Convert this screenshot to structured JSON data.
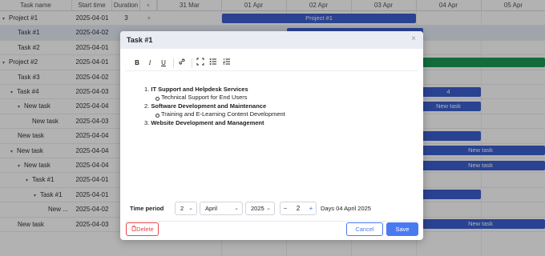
{
  "grid": {
    "columns": [
      "Task name",
      "Start time",
      "Duration",
      "+"
    ]
  },
  "scale": [
    "31 Mar",
    "01 Apr",
    "02 Apr",
    "03 Apr",
    "04 Apr",
    "05 Apr"
  ],
  "rows": [
    {
      "name": "Project #1",
      "start": "2025-04-01",
      "duration": "3",
      "add": "+",
      "caret": "▾"
    },
    {
      "name": "Task #1",
      "start": "2025-04-02"
    },
    {
      "name": "Task #2",
      "start": "2025-04-01"
    },
    {
      "name": "Project #2",
      "start": "2025-04-01",
      "caret": "▾"
    },
    {
      "name": "Task #3",
      "start": "2025-04-02"
    },
    {
      "name": "Task #4",
      "start": "2025-04-03",
      "caret": "▾"
    },
    {
      "name": "New task",
      "start": "2025-04-04",
      "caret": "▾"
    },
    {
      "name": "New task",
      "start": "2025-04-03"
    },
    {
      "name": "New task",
      "start": "2025-04-04"
    },
    {
      "name": "New task",
      "start": "2025-04-04",
      "caret": "▾"
    },
    {
      "name": "New task",
      "start": "2025-04-04",
      "caret": "▾"
    },
    {
      "name": "Task #1",
      "start": "2025-04-01",
      "caret": "▾"
    },
    {
      "name": "Task #1",
      "start": "2025-04-01",
      "caret": "▾"
    },
    {
      "name": "New ...",
      "start": "2025-04-02"
    },
    {
      "name": "New task",
      "start": "2025-04-03"
    }
  ],
  "bars": {
    "project1": "Project #1",
    "task4_partial": "4",
    "new_task_labels": [
      "New task",
      "New task",
      "New task",
      "New task"
    ]
  },
  "modal": {
    "title": "Task #1",
    "close": "×",
    "toolbar": {
      "bold": "B",
      "italic": "I",
      "underline": "U",
      "link": "🔗",
      "fullscreen": "⛶",
      "bulleted_list": "☰",
      "numbered_list": "☰"
    },
    "content": [
      {
        "num": "1.",
        "text": "IT Support and Helpdesk Services",
        "sub": [
          "Technical Support for End Users"
        ]
      },
      {
        "num": "2.",
        "text": "Software Development and Maintenance",
        "sub": [
          "Training and E-Learning Content Development"
        ]
      },
      {
        "num": "3.",
        "text": "Website Development and Management",
        "sub": []
      }
    ],
    "time_period": {
      "label": "Time period",
      "day": "2",
      "month": "April",
      "year": "2025",
      "duration_minus": "−",
      "duration": "2",
      "duration_plus": "+",
      "summary": "Days 04 April 2025"
    },
    "buttons": {
      "delete": "Delete",
      "cancel": "Cancel",
      "save": "Save"
    }
  },
  "colors": {
    "bar_blue": "#3c5fd0",
    "bar_green": "#1a9a55",
    "delete_red": "#e5484d",
    "save_blue": "#4a7af2",
    "cancel_border": "#4a7af2"
  }
}
